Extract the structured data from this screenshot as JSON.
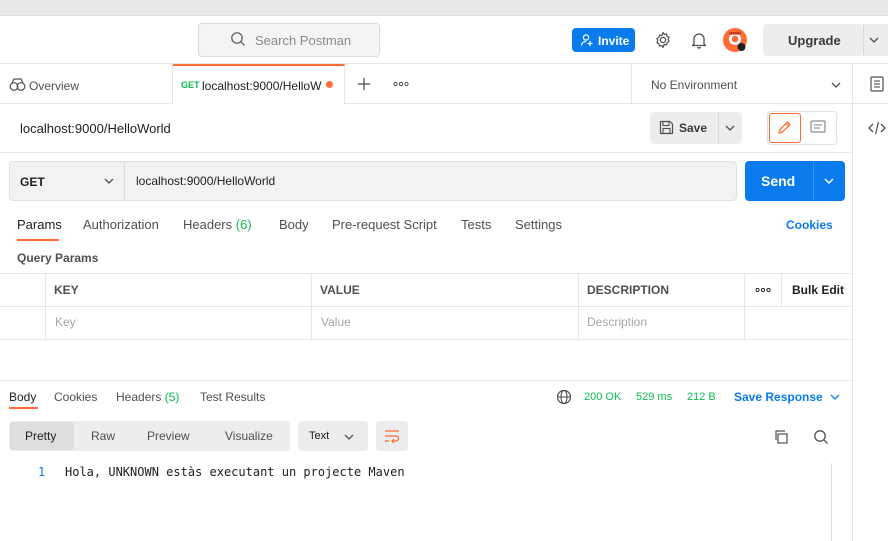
{
  "header": {
    "search_placeholder": "Search Postman",
    "invite_label": "Invite",
    "upgrade_label": "Upgrade"
  },
  "tabs": {
    "overview_label": "Overview",
    "active_method": "GET",
    "active_title": "localhost:9000/HelloW",
    "environment": "No Environment"
  },
  "request": {
    "name": "localhost:9000/HelloWorld",
    "save_label": "Save",
    "method": "GET",
    "url": "localhost:9000/HelloWorld",
    "send_label": "Send",
    "subtabs": {
      "params": "Params",
      "authorization": "Authorization",
      "headers": "Headers",
      "headers_count": "(6)",
      "body": "Body",
      "prerequest": "Pre-request Script",
      "tests": "Tests",
      "settings": "Settings",
      "cookies": "Cookies"
    },
    "query_params_title": "Query Params",
    "table": {
      "col_key": "KEY",
      "col_value": "VALUE",
      "col_description": "DESCRIPTION",
      "bulk_edit": "Bulk Edit",
      "ph_key": "Key",
      "ph_value": "Value",
      "ph_description": "Description"
    }
  },
  "response": {
    "tabs": {
      "body": "Body",
      "cookies": "Cookies",
      "headers": "Headers",
      "headers_count": "(5)",
      "test_results": "Test Results"
    },
    "status": "200 OK",
    "time": "529 ms",
    "size": "212 B",
    "save_response": "Save Response",
    "views": {
      "pretty": "Pretty",
      "raw": "Raw",
      "preview": "Preview",
      "visualize": "Visualize"
    },
    "format": "Text",
    "line_number": "1",
    "body_text": "Hola, UNKNOWN estàs executant un projecte Maven"
  },
  "colors": {
    "accent": "#ff6c37",
    "primary": "#097bed",
    "success": "#0cbb52"
  }
}
